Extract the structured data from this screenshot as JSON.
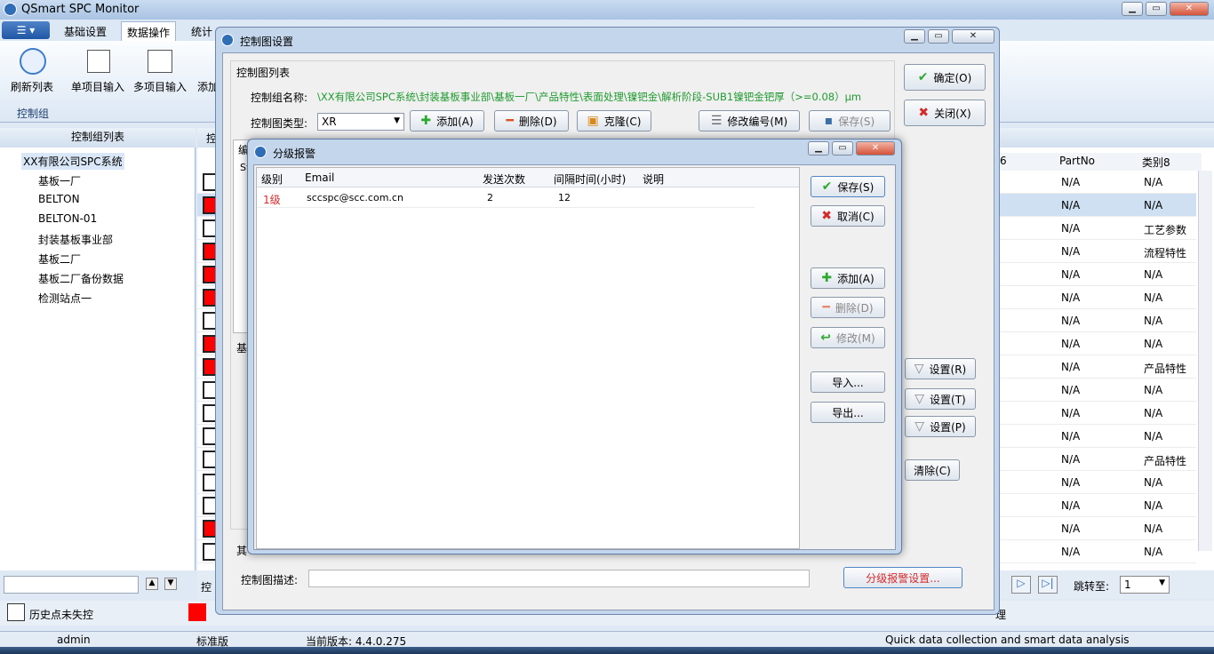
{
  "app": {
    "title": "QSmart SPC Monitor"
  },
  "ribbon": {
    "tabs": [
      "基础设置",
      "数据操作",
      "统计"
    ],
    "buttons": [
      "刷新列表",
      "单项目输入",
      "多项目输入",
      "添加"
    ],
    "group_label": "控制组"
  },
  "tree": {
    "header": "控制组列表",
    "root": "XX有限公司SPC系统",
    "nodes": [
      "基板一厂",
      "BELTON",
      "BELTON-01",
      "封装基板事业部",
      "基板二厂",
      "基板二厂备份数据",
      "检测站点一"
    ]
  },
  "bg_grid": {
    "header_partial": "控",
    "columns": [
      "6",
      "PartNo",
      "类别8"
    ],
    "rows": [
      [
        "N/A",
        "N/A"
      ],
      [
        "N/A",
        "N/A"
      ],
      [
        "N/A",
        "工艺参数"
      ],
      [
        "N/A",
        "流程特性"
      ],
      [
        "N/A",
        "N/A"
      ],
      [
        "N/A",
        "N/A"
      ],
      [
        "N/A",
        "N/A"
      ],
      [
        "N/A",
        "N/A"
      ],
      [
        "N/A",
        "产品特性"
      ],
      [
        "N/A",
        "N/A"
      ],
      [
        "N/A",
        "N/A"
      ],
      [
        "N/A",
        "N/A"
      ],
      [
        "N/A",
        "产品特性"
      ],
      [
        "N/A",
        "N/A"
      ],
      [
        "N/A",
        "N/A"
      ],
      [
        "N/A",
        "N/A"
      ],
      [
        "N/A",
        "N/A"
      ]
    ],
    "jump_label": "跳转至:",
    "jump_value": "1",
    "bottom_partial": "控",
    "legend_label": "历史点未失控",
    "legend_right_partial": "理"
  },
  "status_bar": {
    "user": "admin",
    "edition": "标准版",
    "version": "当前版本: 4.4.0.275",
    "slogan": "Quick data collection and smart data analysis"
  },
  "chart_settings": {
    "title": "控制图设置",
    "section_list": "控制图列表",
    "group_name_label": "控制组名称:",
    "group_name_value": "\\XX有限公司SPC系统\\封装基板事业部\\基板一厂\\产品特性\\表面处理\\镍钯金\\解析阶段-SUB1镍钯金钯厚（>=0.08）μm",
    "type_label": "控制图类型:",
    "type_value": "XR",
    "add": "添加(A)",
    "delete": "删除(D)",
    "clone": "克隆(C)",
    "edit_code": "修改编号(M)",
    "save": "保存(S)",
    "ok": "确定(O)",
    "close": "关闭(X)",
    "set_r": "设置(R)",
    "set_t": "设置(T)",
    "set_p": "设置(P)",
    "clear": "清除(C)",
    "partial_bian": "编",
    "partial_ji": "基",
    "partial_qi": "其",
    "partial_st": "St",
    "desc_label": "控制图描述:",
    "desc_value": "",
    "alarm_settings": "分级报警设置..."
  },
  "alarm_dialog": {
    "title": "分级报警",
    "columns": [
      "级别",
      "Email",
      "发送次数",
      "间隔时间(小时)",
      "说明"
    ],
    "rows": [
      {
        "level": "1级",
        "email": "sccspc@scc.com.cn",
        "count": "2",
        "interval": "12",
        "note": ""
      }
    ],
    "save": "保存(S)",
    "cancel": "取消(C)",
    "add": "添加(A)",
    "delete": "删除(D)",
    "modify": "修改(M)",
    "import": "导入...",
    "export": "导出..."
  }
}
